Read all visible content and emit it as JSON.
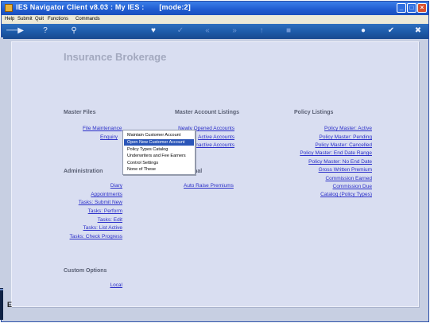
{
  "window": {
    "title": "IES Navigator Client v8.03 : My IES :       [mode:2]",
    "controls": {
      "minimize": "_",
      "maximize": "□",
      "close": "×"
    }
  },
  "menubar": {
    "items": [
      "Help",
      "Submit",
      "Quit",
      "Functions",
      "Commands"
    ]
  },
  "toolbar": {
    "icons": [
      "back-arrow-icon",
      "help-icon",
      "search-icon",
      "heart-icon",
      "check-icon",
      "rewind-icon",
      "fast-forward-icon",
      "up-icon",
      "stop-icon",
      "refresh-icon",
      "confirm-icon",
      "close-icon"
    ]
  },
  "page": {
    "title": "Insurance Brokerage",
    "master_files": {
      "heading": "Master Files",
      "links": [
        "File Maintenance",
        "Enquiry"
      ]
    },
    "administration": {
      "heading": "Administration",
      "links": [
        "Diary",
        "Appointments",
        "Tasks: Submit New",
        "Tasks: Perform",
        "Tasks: Edit",
        "Tasks: List Active",
        "Tasks: Check Progress"
      ]
    },
    "custom_options": {
      "heading": "Custom Options",
      "links": [
        "Local"
      ]
    },
    "master_account_listings": {
      "heading": "Master Account Listings",
      "links": [
        "Newly Opened Accounts",
        "Active Accounts",
        "Inactive Accounts"
      ]
    },
    "additional": {
      "heading": "Additional",
      "links": [
        "Auto Raise Premiums"
      ]
    },
    "policy_listings": {
      "heading": "Policy Listings",
      "links": [
        "Policy Master: Active",
        "Policy Master: Pending",
        "Policy Master: Cancelled",
        "Policy Master: End Date Range",
        "Policy Master: No End Date",
        "Gross Written Premium",
        "Commission Earned",
        "Commission Due",
        "Catalog (Policy Types)"
      ]
    }
  },
  "context_menu": {
    "items": [
      "Maintain Customer Account",
      "Open New Customer Account",
      "Policy Types Catalog",
      "Underwriters and Fee Earners",
      "Control Settings",
      "None of These"
    ],
    "selected": "Open New Customer Account"
  },
  "corner_glyph": "E"
}
